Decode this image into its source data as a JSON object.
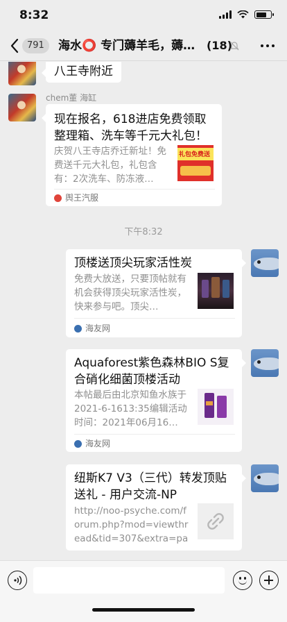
{
  "status_bar": {
    "time": "8:32",
    "signal_icon": "signal-icon",
    "wifi_icon": "wifi-icon",
    "battery_icon": "battery-icon"
  },
  "nav": {
    "back_icon": "chevron-left-icon",
    "unread_badge": "791",
    "title": "海水⭕ 专门薅羊毛，薅…",
    "member_count": "(18)",
    "mute_icon": "bell-off-icon",
    "more_icon": "more-dots-icon"
  },
  "messages": {
    "partial_text": "八王寺附近",
    "sender_name": "chem董 海缸",
    "share_card_1": {
      "title": "现在报名，618进店免费领取整理箱、洗车等千元大礼包！",
      "desc": "庆贺八王寺店乔迁新址！免费送千元大礼包，礼包含有：2次洗车、防冻液…",
      "thumb_text": "礼包免费送",
      "source": "舆王汽服"
    },
    "timestamp": "下午8:32",
    "share_card_2": {
      "title": "顶楼送顶尖玩家活性炭",
      "desc": "免费大放送，只要顶帖就有机会获得顶尖玩家活性炭，快来参与吧。顶尖…",
      "source": "海友网"
    },
    "share_card_3": {
      "title": "Aquaforest紫色森林BIO S复合硝化细菌顶楼活动",
      "desc": "本帖最后由北京知鱼水族于2021-6-1613:35编辑活动时间：2021年06月16…",
      "source": "海友网"
    },
    "share_card_4": {
      "title": "纽斯K7 V3（三代）转发顶贴送礼 - 用户交流-NP",
      "desc": "http://noo-psyche.com/forum.php?mod=viewthread&tid=307&extra=page…",
      "link_icon": "link-icon"
    }
  },
  "input_bar": {
    "voice_icon": "voice-icon",
    "input_value": "",
    "emoji_icon": "emoji-icon",
    "plus_icon": "plus-icon"
  },
  "colors": {
    "background": "#ededed",
    "bubble": "#ffffff",
    "muted_text": "#8f8f8f",
    "source_red": "#e0443a",
    "source_blue": "#3a6fb0"
  }
}
